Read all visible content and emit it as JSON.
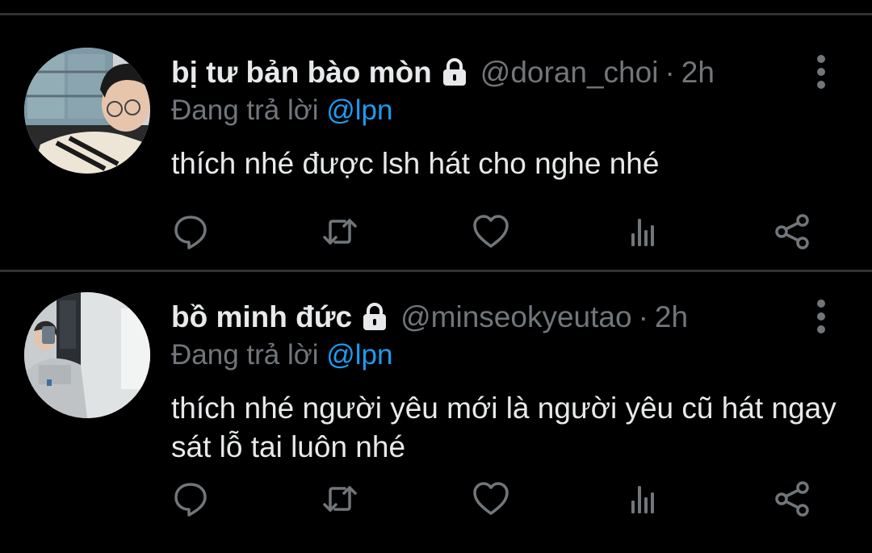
{
  "colors": {
    "background": "#000000",
    "divider": "#2f3336",
    "text_primary": "#e7e9ea",
    "text_secondary": "#71767b",
    "mention": "#1d9bf0"
  },
  "tweets": [
    {
      "display_name": "bị tư bản bào mòn",
      "protected_icon": "lock-icon",
      "handle": "@doran_choi",
      "separator": "·",
      "time": "2h",
      "reply_prefix": "Đang trả lời",
      "reply_to": "@lpn",
      "text": "thích nhé được lsh hát cho nghe nhé",
      "actions": [
        "reply-icon",
        "retweet-icon",
        "like-icon",
        "analytics-icon",
        "share-icon"
      ]
    },
    {
      "display_name": "bồ minh đức",
      "protected_icon": "lock-icon",
      "handle": "@minseokyeutao",
      "separator": "·",
      "time": "2h",
      "reply_prefix": "Đang trả lời",
      "reply_to": "@lpn",
      "text": "thích nhé người yêu mới là người yêu cũ hát ngay sát lỗ tai luôn nhé",
      "actions": [
        "reply-icon",
        "retweet-icon",
        "like-icon",
        "analytics-icon",
        "share-icon"
      ]
    }
  ]
}
